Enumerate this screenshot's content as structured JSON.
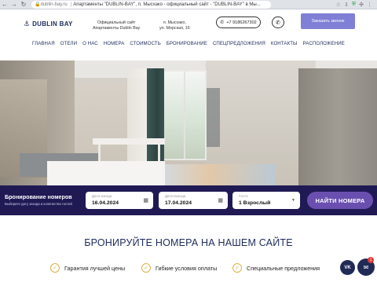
{
  "browser": {
    "host": "dublin-bay.ru",
    "tab_title": "Апартаменты \"DUBLIN-BAY\", п. Мысхако - официальный сайт - \"DUBLIN-BAY\" в Мы..."
  },
  "header": {
    "logo_text": "DUBLIN BAY",
    "tagline_line1": "Официальный сайт",
    "tagline_line2": "Апартаменты Dublin Bay",
    "address_line1": "п. Мысхако,",
    "address_line2": "ул. Морская, 16",
    "phone": "+7 9186267302",
    "callback_label": "Заказать звонок"
  },
  "menu": [
    "ГЛАВНАЯ",
    "ОТЕЛИ",
    "О НАС",
    "НОМЕРА",
    "СТОИМОСТЬ",
    "БРОНИРОВАНИЕ",
    "СПЕЦПРЕДЛОЖЕНИЯ",
    "КОНТАКТЫ",
    "РАСПОЛОЖЕНИЕ"
  ],
  "booking": {
    "title": "Бронирование номеров",
    "subtitle": "Выберите дату заезда и количество гостей",
    "checkin_label": "Дата заезда",
    "checkin_value": "16.04.2024",
    "checkout_label": "Дата выезда",
    "checkout_value": "17.04.2024",
    "guests_label": "Гости",
    "guests_value": "1 Взрослый",
    "find_label": "НАЙТИ НОМЕРА"
  },
  "section": {
    "title": "БРОНИРУЙТЕ НОМЕРА НА НАШЕМ САЙТЕ"
  },
  "features": [
    "Гарантия лучшей цены",
    "Гибкие условия оплаты",
    "Специальные предложения"
  ],
  "widgets": {
    "vk_label": "VK",
    "chat_badge": "1"
  },
  "colors": {
    "brand_navy": "#1d2b5a",
    "booking_bar": "#1f1a54",
    "accent_purple": "#6a4fb0",
    "callback_button": "#7f7fd6",
    "feature_check": "#d9b24a"
  }
}
